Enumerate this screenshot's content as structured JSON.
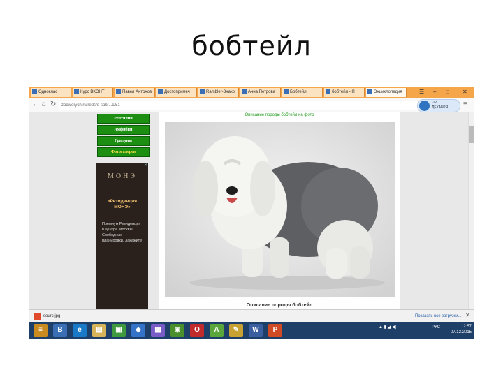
{
  "slide": {
    "title": "бобтейл"
  },
  "browser": {
    "tabs": [
      {
        "label": "Одноклас"
      },
      {
        "label": "Курс ВКОНТ"
      },
      {
        "label": "Павел Антонов"
      },
      {
        "label": "Достопримеч"
      },
      {
        "label": "Rambler-Знако"
      },
      {
        "label": "Анна Петрова"
      },
      {
        "label": "Бобтейл"
      },
      {
        "label": "бобтейл - Я"
      },
      {
        "label": "Энциклопедия"
      }
    ],
    "url": "zooworych.ru/reds/e-sob/...c/51",
    "yandex_badge": {
      "count": "-12",
      "text": "ДЕКАБРЯ"
    }
  },
  "page": {
    "menu": [
      {
        "label": "Рептилии"
      },
      {
        "label": "Амфибии"
      },
      {
        "label": "Грызуны"
      },
      {
        "label": "Фотогалерея"
      }
    ],
    "caption": "Описание породы бобтейл на фото",
    "heading": "Описание породы бобтейл",
    "ad": {
      "logo": "МОНЭ",
      "sub": "·",
      "headline": "«Резиденция МОНЭ»",
      "body": "Премиум Резиденция в центре Москвы. Свободные планировки. Закажите"
    }
  },
  "download_bar": {
    "file": "sourc.jpg",
    "show_all": "Показать все загрузки..."
  },
  "taskbar": {
    "apps": [
      {
        "name": "explorer",
        "glyph": "≡",
        "color": "#c98a1f"
      },
      {
        "name": "vk",
        "glyph": "B",
        "color": "#3b6fb5"
      },
      {
        "name": "ie",
        "glyph": "e",
        "color": "#1b7ac8"
      },
      {
        "name": "files",
        "glyph": "▤",
        "color": "#d7b35a"
      },
      {
        "name": "store",
        "glyph": "▣",
        "color": "#3f9a3f"
      },
      {
        "name": "dropbox",
        "glyph": "◆",
        "color": "#3473c7"
      },
      {
        "name": "photos",
        "glyph": "▦",
        "color": "#7a5cc7"
      },
      {
        "name": "chrome",
        "glyph": "◉",
        "color": "#4a8f2c"
      },
      {
        "name": "opera",
        "glyph": "O",
        "color": "#c22b2b"
      },
      {
        "name": "android",
        "glyph": "A",
        "color": "#5aa63b"
      },
      {
        "name": "paint",
        "glyph": "✎",
        "color": "#c7a233"
      },
      {
        "name": "word",
        "glyph": "W",
        "color": "#3a5ea0"
      },
      {
        "name": "powerpoint",
        "glyph": "P",
        "color": "#cf4b26"
      }
    ],
    "lang": "РУС",
    "time": "12:57",
    "date": "07.12.2015"
  }
}
